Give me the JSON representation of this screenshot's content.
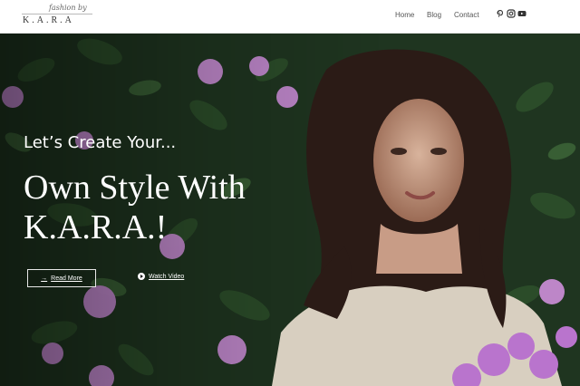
{
  "header": {
    "logo": {
      "script_text": "fashion by",
      "brand_text": "K.A.R.A"
    },
    "nav": [
      {
        "label": "Home"
      },
      {
        "label": "Blog"
      },
      {
        "label": "Contact"
      }
    ],
    "social": [
      {
        "icon": "pinterest-icon"
      },
      {
        "icon": "instagram-icon"
      },
      {
        "icon": "youtube-icon"
      }
    ]
  },
  "hero": {
    "pre_title": "Let’s Create Your...",
    "title": "Own Style With K.A.R.A.!",
    "read_more_label": "Read More",
    "watch_video_label": "Watch Video"
  },
  "colors": {
    "foliage": "#1f3520",
    "flower": "#c68bd2",
    "text": "#ffffff"
  }
}
